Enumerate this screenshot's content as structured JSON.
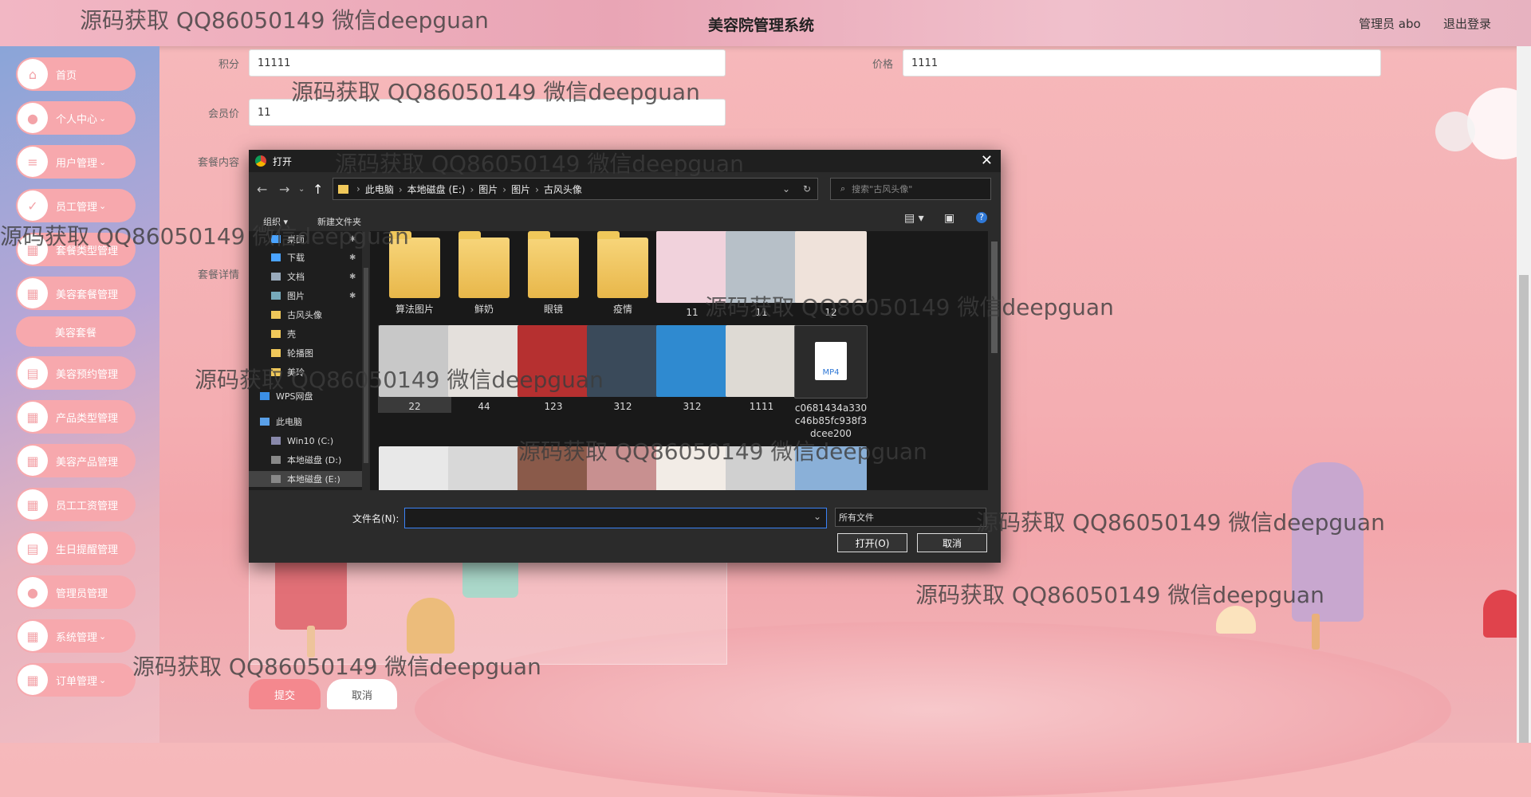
{
  "header": {
    "title": "美容院管理系统",
    "admin": "管理员 abo",
    "logout": "退出登录"
  },
  "sidebar": {
    "items": [
      {
        "label": "首页",
        "icon": "home-icon"
      },
      {
        "label": "个人中心",
        "icon": "user-icon"
      },
      {
        "label": "用户管理",
        "icon": "list-icon"
      },
      {
        "label": "员工管理",
        "icon": "check-icon"
      },
      {
        "label": "套餐类型管理",
        "icon": "grid-icon"
      },
      {
        "label": "美容套餐管理",
        "icon": "grid-icon"
      },
      {
        "label": "美容预约管理",
        "icon": "calendar-icon"
      },
      {
        "label": "产品类型管理",
        "icon": "grid-icon"
      },
      {
        "label": "美容产品管理",
        "icon": "grid-icon"
      },
      {
        "label": "员工工资管理",
        "icon": "grid-icon"
      },
      {
        "label": "生日提醒管理",
        "icon": "calendar-icon"
      },
      {
        "label": "管理员管理",
        "icon": "user-icon"
      },
      {
        "label": "系统管理",
        "icon": "grid-icon"
      },
      {
        "label": "订单管理",
        "icon": "grid-icon"
      }
    ],
    "sub_item": "美容套餐"
  },
  "form": {
    "points_label": "积分",
    "points_value": "11111",
    "price_label": "价格",
    "price_value": "1111",
    "member_price_label": "会员价",
    "member_price_value": "11",
    "content_label": "套餐内容",
    "detail_label": "套餐详情",
    "submit": "提交",
    "cancel": "取消"
  },
  "dialog": {
    "title": "打开",
    "close": "✕",
    "breadcrumb": [
      "此电脑",
      "本地磁盘 (E:)",
      "图片",
      "图片",
      "古风头像"
    ],
    "search_placeholder": "搜索\"古风头像\"",
    "organize": "组织 ▾",
    "new_folder": "新建文件夹",
    "nav_items": [
      "桌面",
      "下载",
      "文档",
      "图片",
      "古风头像",
      "壳",
      "轮播图",
      "美玲",
      "WPS网盘",
      "此电脑",
      "Win10 (C:)",
      "本地磁盘 (D:)",
      "本地磁盘 (E:)"
    ],
    "files_row1": [
      "算法图片",
      "鲜奶",
      "眼镜",
      "疫情",
      "11",
      "11",
      "12"
    ],
    "files_row2": [
      "22",
      "44",
      "123",
      "312",
      "312",
      "1111",
      "c0681434a330c46b85fc938f3dcee200"
    ],
    "filename_label": "文件名(N):",
    "filetype": "所有文件",
    "open_button": "打开(O)",
    "cancel_button": "取消",
    "mp4_label": "MP4"
  },
  "watermark": "源码获取 QQ86050149 微信deepguan",
  "colors": {
    "accent": "#f7a8ad",
    "submit": "#f4888e",
    "dialog_bg": "#2b2b2b"
  }
}
